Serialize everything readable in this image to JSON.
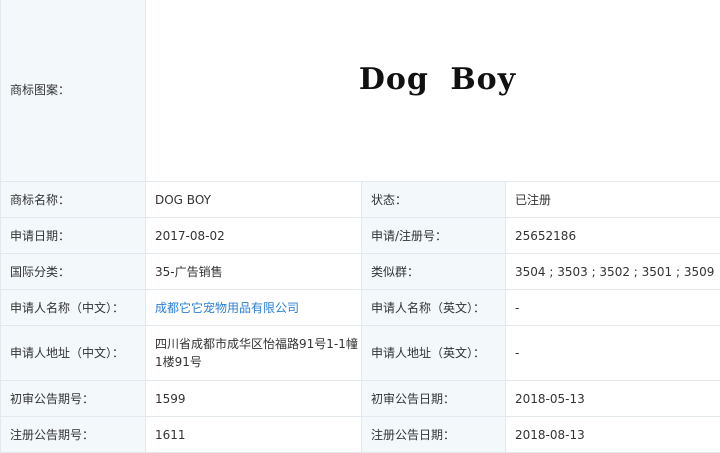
{
  "trademark": {
    "image_label": "商标图案：",
    "logo_text": "Dog Boy",
    "fields": {
      "name": {
        "label": "商标名称：",
        "value": "DOG BOY"
      },
      "status": {
        "label": "状态：",
        "value": "已注册"
      },
      "apply_date": {
        "label": "申请日期：",
        "value": "2017-08-02"
      },
      "reg_no": {
        "label": "申请/注册号：",
        "value": "25652186"
      },
      "intl_class": {
        "label": "国际分类：",
        "value": "35-广告销售"
      },
      "similar_group": {
        "label": "类似群：",
        "value": "3504 ; 3503 ; 3502 ; 3501 ; 3509"
      },
      "applicant_cn": {
        "label": "申请人名称（中文）：",
        "value": "成都它它宠物用品有限公司"
      },
      "applicant_en": {
        "label": "申请人名称（英文）：",
        "value": "-"
      },
      "address_cn": {
        "label": "申请人地址（中文）：",
        "value": "四川省成都市成华区怡福路91号1-1幢1楼91号"
      },
      "address_en": {
        "label": "申请人地址（英文）：",
        "value": "-"
      },
      "prelim_no": {
        "label": "初审公告期号：",
        "value": "1599"
      },
      "prelim_date": {
        "label": "初审公告日期：",
        "value": "2018-05-13"
      },
      "reg_pub_no": {
        "label": "注册公告期号：",
        "value": "1611"
      },
      "reg_pub_date": {
        "label": "注册公告日期：",
        "value": "2018-08-13"
      }
    }
  },
  "colors": {
    "label_bg": "#f3f8fb",
    "border": "#e3e8ee",
    "link": "#2b7fd3",
    "text": "#333333"
  }
}
